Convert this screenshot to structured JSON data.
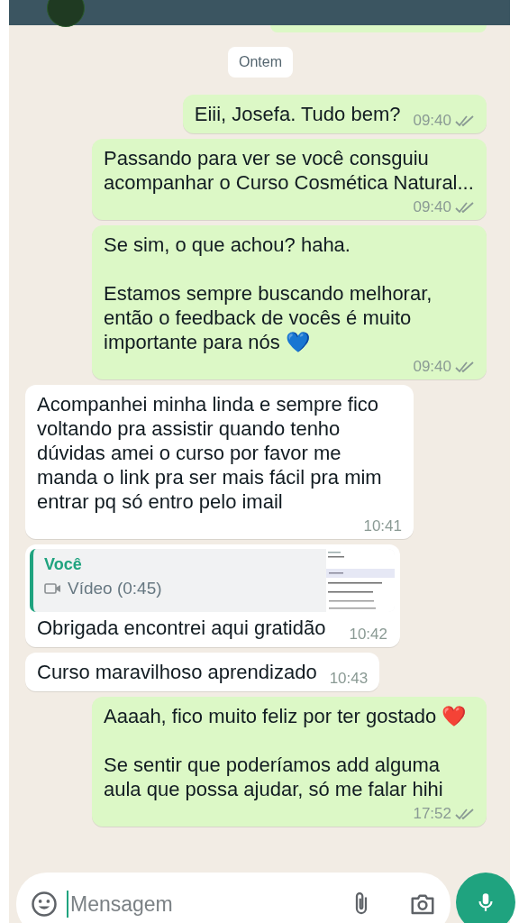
{
  "date_chip": "Ontem",
  "messages": [
    {
      "kind": "out",
      "text": "Eiii, Josefa. Tudo bem?",
      "time": "09:40",
      "read": false
    },
    {
      "kind": "out",
      "text": "Passando para ver se você consguiu acompanhar o Curso Cosmética Natural...",
      "time": "09:40",
      "read": false
    },
    {
      "kind": "out",
      "text": "Se sim, o que achou? haha.\n\nEstamos sempre buscando melhorar, então o feedback de vocês é muito importante para nós 💙",
      "time": "09:40",
      "read": false
    },
    {
      "kind": "in",
      "text": "Acompanhei minha linda e sempre fico voltando pra assistir quando tenho dúvidas amei o curso por favor me manda o link pra ser mais fácil pra mim entrar pq só entro pelo imail",
      "time": "10:41"
    },
    {
      "kind": "reply",
      "quote_author": "Você",
      "quote_label": "Vídeo (0:45)",
      "text": "Obrigada encontrei aqui gratidão",
      "time": "10:42"
    },
    {
      "kind": "in",
      "text": "Curso maravilhoso aprendizado",
      "time": "10:43"
    },
    {
      "kind": "out",
      "text": "Aaaah, fico muito feliz por ter gostado ❤️\n\nSe sentir que poderíamos add alguma aula que possa ajudar, só me falar hihi",
      "time": "17:52",
      "read": false
    }
  ],
  "composer": {
    "placeholder": "Mensagem"
  }
}
